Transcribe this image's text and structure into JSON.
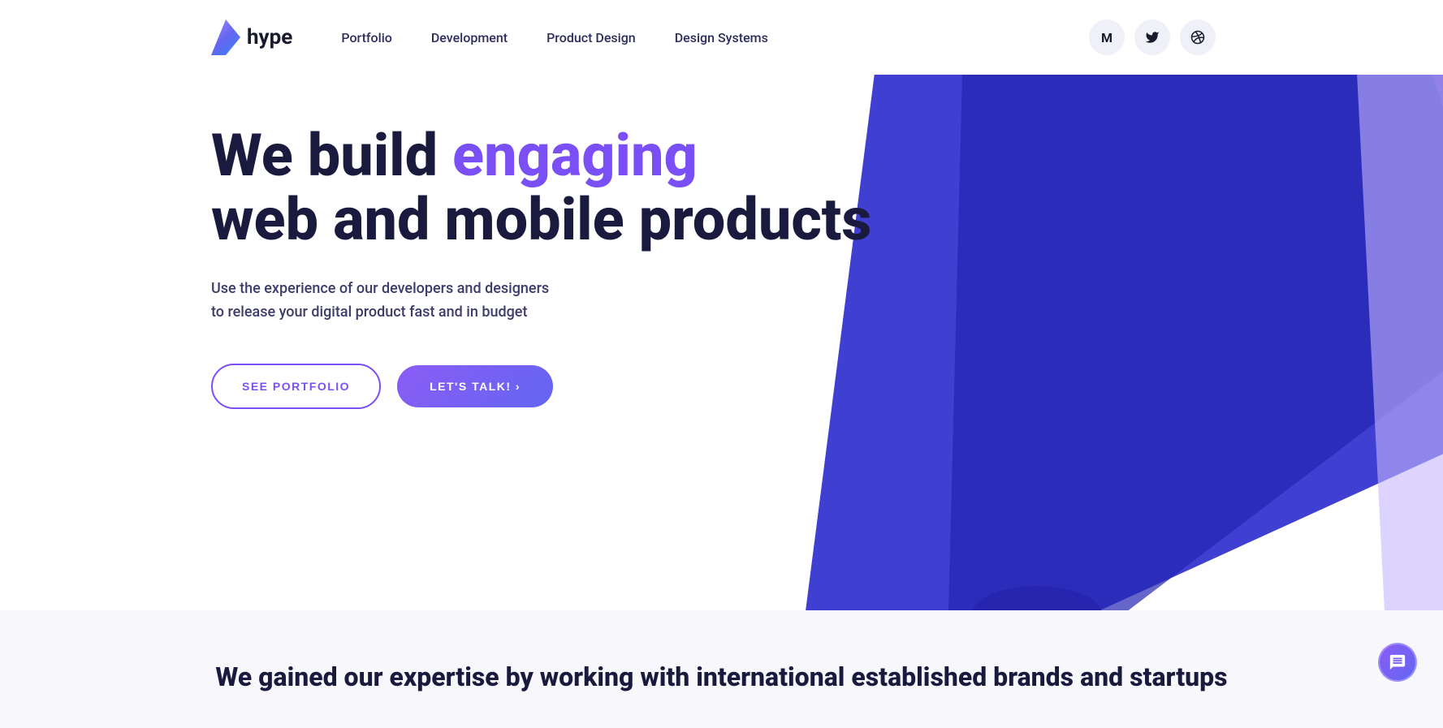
{
  "brand": {
    "logo_text": "hype",
    "logo_icon_alt": "hype logo"
  },
  "nav": {
    "links": [
      {
        "label": "Portfolio",
        "id": "portfolio"
      },
      {
        "label": "Development",
        "id": "development"
      },
      {
        "label": "Product Design",
        "id": "product-design"
      },
      {
        "label": "Design Systems",
        "id": "design-systems"
      }
    ]
  },
  "social": {
    "medium_label": "M",
    "twitter_label": "🐦",
    "dribbble_label": "🏀"
  },
  "hero": {
    "heading_part1": "We build ",
    "heading_accent": "engaging",
    "heading_part2": "web and mobile products",
    "subtext": "Use the experience of our developers and designers to release your digital product fast and in budget",
    "btn_portfolio": "SEE PORTFOLIO",
    "btn_talk": "LET'S TALK! ›"
  },
  "bottom": {
    "heading": "We gained our expertise by working with international established brands and startups"
  },
  "colors": {
    "accent": "#7b4ff6",
    "dark": "#1a1a3e",
    "blue_shape": "#3a3adb",
    "purple_shape": "#c4b5fd",
    "pink_shape": "#f0abfc"
  }
}
